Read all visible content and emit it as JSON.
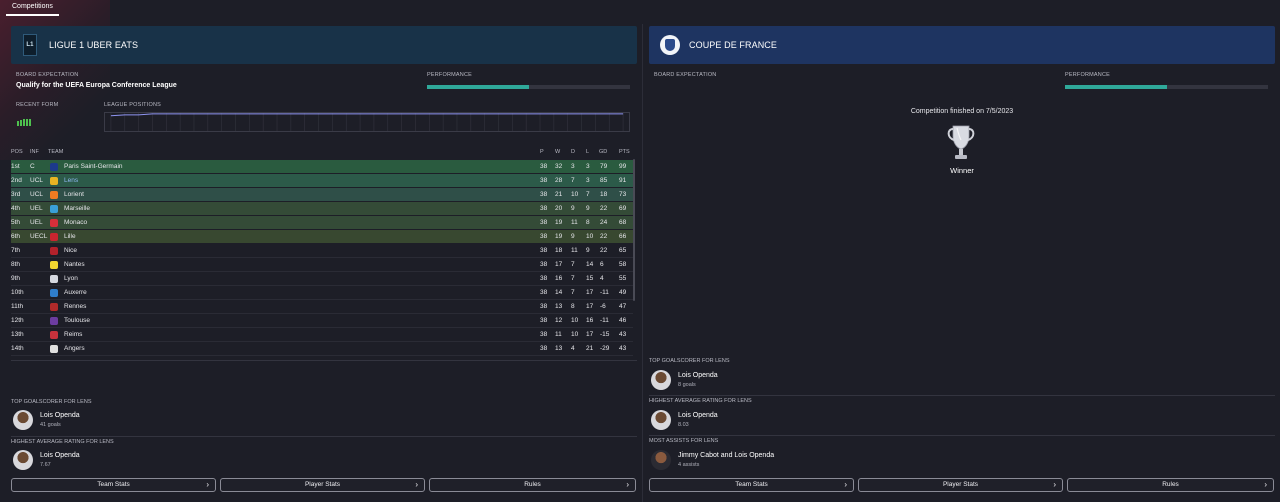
{
  "tabs": [
    {
      "label": "Competitions",
      "active": true
    }
  ],
  "colors": {
    "performance_fill": "#2fa99a",
    "form_bar": "#4ec14e",
    "link": "#8fb7f2"
  },
  "league": {
    "logo_text": "L1",
    "name": "LIGUE 1 UBER EATS",
    "board_expectation_label": "BOARD EXPECTATION",
    "board_expectation_value": "Qualify for the UEFA Europa Conference League",
    "performance_label": "PERFORMANCE",
    "performance_fraction": 0.5,
    "recent_form_label": "RECENT FORM",
    "recent_form": [
      3,
      4,
      5,
      5,
      5
    ],
    "league_positions_label": "LEAGUE POSITIONS",
    "league_positions": [
      4,
      3,
      3,
      2,
      2,
      2,
      2,
      2,
      2,
      2,
      2,
      2,
      2,
      2,
      2,
      2,
      2,
      2,
      2,
      2,
      2,
      2,
      2,
      2,
      2,
      2,
      2,
      2,
      2,
      2,
      2,
      2,
      2,
      2,
      2,
      2,
      2,
      2
    ],
    "table_headers": {
      "pos": "POS",
      "inf": "INF",
      "team": "TEAM",
      "p": "P",
      "w": "W",
      "d": "D",
      "l": "L",
      "gd": "GD",
      "pts": "PTS"
    },
    "table": [
      {
        "pos": "1st",
        "inf": "C",
        "team": "Paris Saint-Germain",
        "p": "38",
        "w": "32",
        "d": "3",
        "l": "3",
        "gd": "79",
        "pts": "99",
        "badge": "#1c3a8a"
      },
      {
        "pos": "2nd",
        "inf": "UCL",
        "team": "Lens",
        "p": "38",
        "w": "28",
        "d": "7",
        "l": "3",
        "gd": "85",
        "pts": "91",
        "badge": "#e8b323"
      },
      {
        "pos": "3rd",
        "inf": "UCL",
        "team": "Lorient",
        "p": "38",
        "w": "21",
        "d": "10",
        "l": "7",
        "gd": "18",
        "pts": "73",
        "badge": "#f07b21"
      },
      {
        "pos": "4th",
        "inf": "UEL",
        "team": "Marseille",
        "p": "38",
        "w": "20",
        "d": "9",
        "l": "9",
        "gd": "22",
        "pts": "69",
        "badge": "#3aa0d8"
      },
      {
        "pos": "5th",
        "inf": "UEL",
        "team": "Monaco",
        "p": "38",
        "w": "19",
        "d": "11",
        "l": "8",
        "gd": "24",
        "pts": "68",
        "badge": "#d62f3a"
      },
      {
        "pos": "6th",
        "inf": "UECL",
        "team": "Lille",
        "p": "38",
        "w": "19",
        "d": "9",
        "l": "10",
        "gd": "22",
        "pts": "66",
        "badge": "#c8252f"
      },
      {
        "pos": "7th",
        "inf": "",
        "team": "Nice",
        "p": "38",
        "w": "18",
        "d": "11",
        "l": "9",
        "gd": "22",
        "pts": "65",
        "badge": "#b3222b"
      },
      {
        "pos": "8th",
        "inf": "",
        "team": "Nantes",
        "p": "38",
        "w": "17",
        "d": "7",
        "l": "14",
        "gd": "6",
        "pts": "58",
        "badge": "#f2d630"
      },
      {
        "pos": "9th",
        "inf": "",
        "team": "Lyon",
        "p": "38",
        "w": "16",
        "d": "7",
        "l": "15",
        "gd": "4",
        "pts": "55",
        "badge": "#d5d8e0"
      },
      {
        "pos": "10th",
        "inf": "",
        "team": "Auxerre",
        "p": "38",
        "w": "14",
        "d": "7",
        "l": "17",
        "gd": "-11",
        "pts": "49",
        "badge": "#2f7ecb"
      },
      {
        "pos": "11th",
        "inf": "",
        "team": "Rennes",
        "p": "38",
        "w": "13",
        "d": "8",
        "l": "17",
        "gd": "-6",
        "pts": "47",
        "badge": "#b02a2a"
      },
      {
        "pos": "12th",
        "inf": "",
        "team": "Toulouse",
        "p": "38",
        "w": "12",
        "d": "10",
        "l": "16",
        "gd": "-11",
        "pts": "46",
        "badge": "#6c3ca0"
      },
      {
        "pos": "13th",
        "inf": "",
        "team": "Reims",
        "p": "38",
        "w": "11",
        "d": "10",
        "l": "17",
        "gd": "-15",
        "pts": "43",
        "badge": "#c7323c"
      },
      {
        "pos": "14th",
        "inf": "",
        "team": "Angers",
        "p": "38",
        "w": "13",
        "d": "4",
        "l": "21",
        "gd": "-29",
        "pts": "43",
        "badge": "#e0e0e0"
      }
    ],
    "top_goalscorer_label": "TOP GOALSCORER FOR LENS",
    "top_goalscorer": {
      "name": "Lois Openda",
      "detail": "41 goals"
    },
    "highest_rating_label": "HIGHEST AVERAGE RATING FOR LENS",
    "highest_rating": {
      "name": "Lois Openda",
      "detail": "7.67"
    },
    "buttons": [
      {
        "label": "Team Stats"
      },
      {
        "label": "Player Stats"
      },
      {
        "label": "Rules"
      }
    ]
  },
  "cup": {
    "name": "COUPE DE FRANCE",
    "board_expectation_label": "BOARD EXPECTATION",
    "performance_label": "PERFORMANCE",
    "performance_fraction": 0.5,
    "finished_text": "Competition finished on 7/5/2023",
    "result": "Winner",
    "top_goalscorer_label": "TOP GOALSCORER FOR LENS",
    "top_goalscorer": {
      "name": "Lois Openda",
      "detail": "8 goals"
    },
    "highest_rating_label": "HIGHEST AVERAGE RATING FOR LENS",
    "highest_rating": {
      "name": "Lois Openda",
      "detail": "8.03"
    },
    "most_assists_label": "MOST ASSISTS FOR LENS",
    "most_assists": {
      "name": "Jimmy Cabot and Lois Openda",
      "detail": "4 assists"
    },
    "buttons": [
      {
        "label": "Team Stats"
      },
      {
        "label": "Player Stats"
      },
      {
        "label": "Rules"
      }
    ]
  }
}
